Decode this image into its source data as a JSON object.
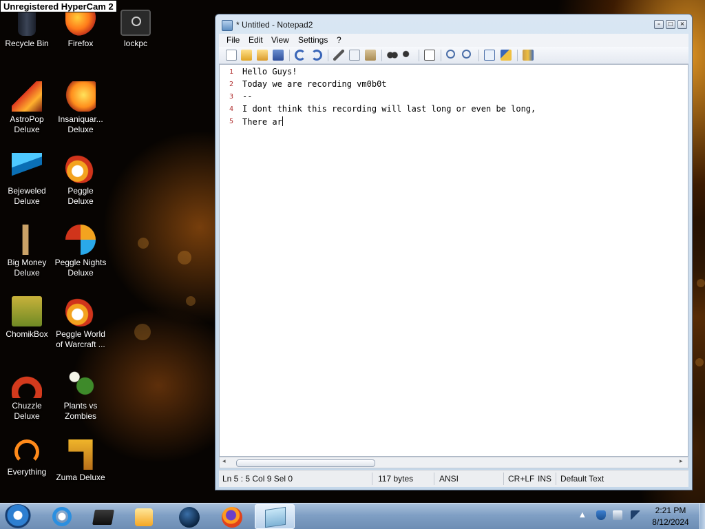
{
  "watermark": "Unregistered HyperCam 2",
  "desktop": {
    "icons": [
      {
        "label": "Recycle Bin",
        "icon": "recycle-bin-icon"
      },
      {
        "label": "Firefox",
        "icon": "firefox-icon"
      },
      {
        "label": "lockpc",
        "icon": "lockpc-icon"
      },
      {
        "label": "AstroPop Deluxe",
        "icon": "astropop-icon"
      },
      {
        "label": "Insaniquar... Deluxe",
        "icon": "insaniquarium-icon"
      },
      {
        "label": "Bejeweled Deluxe",
        "icon": "bejeweled-icon"
      },
      {
        "label": "Peggle Deluxe",
        "icon": "peggle-icon"
      },
      {
        "label": "Big Money Deluxe",
        "icon": "big-money-icon"
      },
      {
        "label": "Peggle Nights Deluxe",
        "icon": "peggle-nights-icon"
      },
      {
        "label": "ChomikBox",
        "icon": "chomikbox-icon"
      },
      {
        "label": "Peggle World of Warcraft ...",
        "icon": "peggle-wow-icon"
      },
      {
        "label": "Chuzzle Deluxe",
        "icon": "chuzzle-icon"
      },
      {
        "label": "Plants vs Zombies",
        "icon": "plants-vs-zombies-icon"
      },
      {
        "label": "Everything",
        "icon": "everything-icon"
      },
      {
        "label": "Zuma Deluxe",
        "icon": "zuma-icon"
      }
    ]
  },
  "notepad": {
    "title": "* Untitled - Notepad2",
    "menu": [
      "File",
      "Edit",
      "View",
      "Settings",
      "?"
    ],
    "toolbar_icons": [
      "new-icon",
      "open-icon",
      "browse-icon",
      "save-icon",
      "undo-icon",
      "redo-icon",
      "cut-icon",
      "copy-icon",
      "paste-icon",
      "find-icon",
      "replace-icon",
      "word-wrap-icon",
      "zoom-in-icon",
      "zoom-out-icon",
      "scheme-icon",
      "customize-icon",
      "exit-icon"
    ],
    "line_numbers": [
      "1",
      "2",
      "3",
      "4",
      "5"
    ],
    "lines": [
      "Hello Guys!",
      "Today we are recording vm0b0t",
      "--",
      "I dont think this recording will last long or even be long,",
      "There ar"
    ],
    "status": {
      "position": "Ln 5 : 5   Col 9   Sel 0",
      "size": "117 bytes",
      "encoding": "ANSI",
      "line_endings": "CR+LF",
      "mode": "INS",
      "scheme": "Default Text"
    }
  },
  "taskbar": {
    "apps": [
      "internet-explorer-icon",
      "media-center-icon",
      "media-player-icon",
      "globe-icon",
      "firefox-icon",
      "notepad2-icon"
    ],
    "tray_icons": [
      "security-icon",
      "network-icon",
      "volume-icon"
    ],
    "clock_time": "2:21 PM",
    "clock_date": "8/12/2024"
  }
}
